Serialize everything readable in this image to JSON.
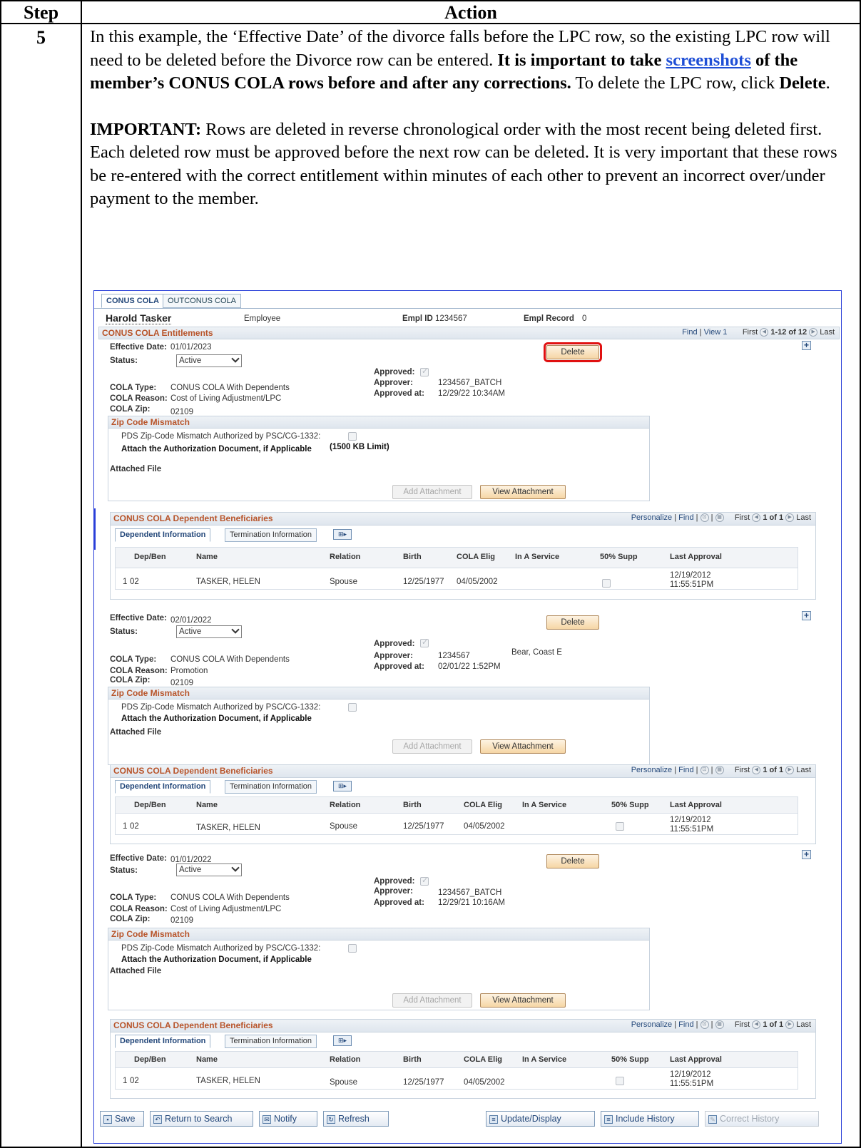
{
  "doc": {
    "header_step": "Step",
    "header_action": "Action",
    "step_number": "5",
    "para1_a": "In this example, the ‘Effective Date’ of the divorce falls before the LPC row, so the existing LPC row will need to be deleted before the Divorce row can be entered.",
    "para1_b": "It is important to take",
    "para1_link": "screenshots",
    "para1_c": "of the member’s CONUS COLA rows before and after any corrections.",
    "para1_d": "To delete the LPC row, click",
    "para1_e": "Delete",
    "para2_label": "IMPORTANT:",
    "para2_text": "Rows are deleted in reverse chronological order with the most recent being deleted first.  Each deleted row must be approved before the next row can be deleted.  It is very important that these rows be re-entered with the correct entitlement within minutes of each other to prevent an incorrect over/under payment to the member."
  },
  "app": {
    "tabs": [
      "CONUS COLA",
      "OUTCONUS COLA"
    ],
    "employee_name": "Harold Tasker",
    "employee_label": "Employee",
    "empl_id_label": "Empl ID",
    "empl_id": "1234567",
    "empl_record_label": "Empl Record",
    "empl_record": "0",
    "section_title": "CONUS COLA Entitlements",
    "find": "Find",
    "view1": "View 1",
    "first": "First",
    "range": "1-12 of 12",
    "last": "Last",
    "labels": {
      "effective_date": "Effective Date:",
      "status": "Status:",
      "approved": "Approved:",
      "approver": "Approver:",
      "approved_at": "Approved at:",
      "cola_type": "COLA Type:",
      "cola_reason": "COLA Reason:",
      "cola_zip": "COLA Zip:",
      "zip_mismatch": "Zip Code Mismatch",
      "pds_zip": "PDS Zip-Code Mismatch Authorized by PSC/CG-1332:",
      "attach_doc": "Attach the Authorization Document, if Applicable",
      "kb_limit": "(1500 KB Limit)",
      "attached_file": "Attached File",
      "add_attachment": "Add Attachment",
      "view_attachment": "View Attachment",
      "delete": "Delete",
      "dep_title": "CONUS COLA Dependent Beneficiaries",
      "personalize": "Personalize",
      "dep_range": "1 of 1",
      "tab_dep_info": "Dependent Information",
      "tab_term_info": "Termination Information"
    },
    "grid_columns": [
      "Dep/Ben",
      "Name",
      "Relation",
      "Birth",
      "COLA Elig",
      "In A Service",
      "50% Supp",
      "Last Approval"
    ],
    "rows": [
      {
        "effective_date": "01/01/2023",
        "status": "Active",
        "approver": "1234567_BATCH",
        "approver_name": "",
        "approved_at": "12/29/22 10:34AM",
        "cola_type": "CONUS COLA With Dependents",
        "cola_reason": "Cost of Living Adjustment/LPC",
        "cola_zip": "02109",
        "dep": {
          "num": "1",
          "depben": "02",
          "name": "TASKER, HELEN",
          "relation": "Spouse",
          "birth": "12/25/1977",
          "cola_elig": "04/05/2002",
          "last_approval_date": "12/19/2012",
          "last_approval_time": "11:55:51PM"
        }
      },
      {
        "effective_date": "02/01/2022",
        "status": "Active",
        "approver": "1234567",
        "approver_name": "Bear, Coast E",
        "approved_at": "02/01/22  1:52PM",
        "cola_type": "CONUS COLA With Dependents",
        "cola_reason": "Promotion",
        "cola_zip": "02109",
        "dep": {
          "num": "1",
          "depben": "02",
          "name": "TASKER, HELEN",
          "relation": "Spouse",
          "birth": "12/25/1977",
          "cola_elig": "04/05/2002",
          "last_approval_date": "12/19/2012",
          "last_approval_time": "11:55:51PM"
        }
      },
      {
        "effective_date": "01/01/2022",
        "status": "Active",
        "approver": "1234567_BATCH",
        "approver_name": "",
        "approved_at": "12/29/21 10:16AM",
        "cola_type": "CONUS COLA With Dependents",
        "cola_reason": "Cost of Living Adjustment/LPC",
        "cola_zip": "02109",
        "dep": {
          "num": "1",
          "depben": "02",
          "name": "TASKER, HELEN",
          "relation": "Spouse",
          "birth": "12/25/1977",
          "cola_elig": "04/05/2002",
          "last_approval_date": "12/19/2012",
          "last_approval_time": "11:55:51PM"
        }
      }
    ],
    "toolbar": {
      "save": "Save",
      "return": "Return to Search",
      "notify": "Notify",
      "refresh": "Refresh",
      "update": "Update/Display",
      "include": "Include History",
      "correct": "Correct History"
    },
    "colors": {
      "frame": "#2a3fd8",
      "section_title": "#b8542a",
      "highlight": "#e01010",
      "link": "#1f4fd6"
    }
  }
}
